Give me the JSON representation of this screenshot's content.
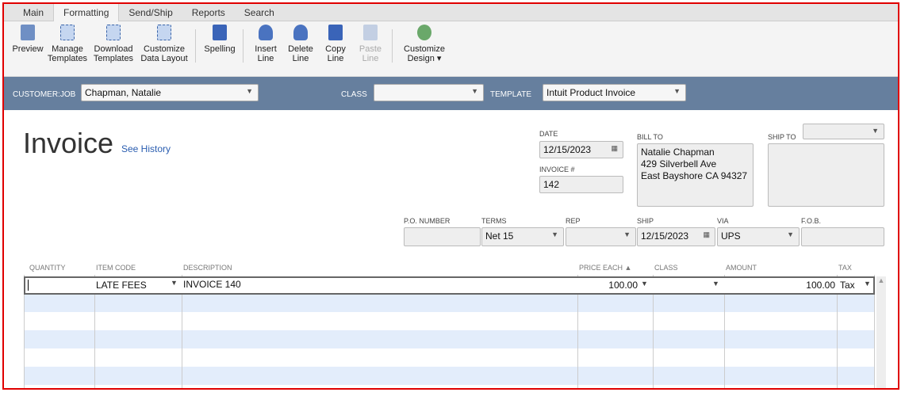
{
  "tabs": [
    "Main",
    "Formatting",
    "Send/Ship",
    "Reports",
    "Search"
  ],
  "toolbar": {
    "preview": [
      "Preview",
      ""
    ],
    "manage": [
      "Manage",
      "Templates"
    ],
    "download": [
      "Download",
      "Templates"
    ],
    "customize_layout": [
      "Customize",
      "Data Layout"
    ],
    "spelling": [
      "Spelling",
      ""
    ],
    "insert": [
      "Insert",
      "Line"
    ],
    "delete": [
      "Delete",
      "Line"
    ],
    "copy": [
      "Copy",
      "Line"
    ],
    "paste": [
      "Paste",
      "Line"
    ],
    "design": [
      "Customize",
      "Design ▾"
    ]
  },
  "header": {
    "customer_label": "CUSTOMER:JOB",
    "customer": "Chapman, Natalie",
    "class_label": "CLASS",
    "class": "",
    "template_label": "TEMPLATE",
    "template": "Intuit Product Invoice"
  },
  "form": {
    "title": "Invoice",
    "see_history": "See History",
    "date_label": "DATE",
    "date": "12/15/2023",
    "invoice_label": "INVOICE #",
    "invoice_no": "142",
    "bill_to_label": "BILL TO",
    "bill_to": [
      "Natalie Chapman",
      "429 Silverbell Ave",
      "East Bayshore CA 94327"
    ],
    "ship_to_label": "SHIP TO",
    "po_label": "P.O. NUMBER",
    "po": "",
    "terms_label": "TERMS",
    "terms": "Net 15",
    "rep_label": "REP",
    "rep": "",
    "ship_label": "SHIP",
    "ship": "12/15/2023",
    "via_label": "VIA",
    "via": "UPS",
    "fob_label": "F.O.B.",
    "fob": ""
  },
  "table": {
    "columns": [
      "QUANTITY",
      "ITEM CODE",
      "DESCRIPTION",
      "PRICE EACH ▲",
      "CLASS",
      "AMOUNT",
      "TAX"
    ],
    "rows": [
      {
        "quantity": "",
        "item": "LATE FEES",
        "description": "INVOICE 140",
        "price": "100.00",
        "class": "",
        "amount": "100.00",
        "tax": "Tax"
      }
    ]
  }
}
